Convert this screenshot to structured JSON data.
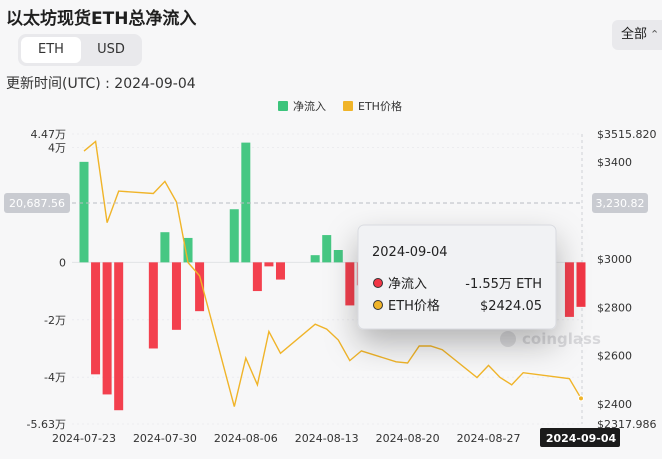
{
  "header": {
    "title": "以太坊现货ETH总净流入",
    "unit_toggle": [
      "ETH",
      "USD"
    ],
    "active_unit": "ETH",
    "update_time": "更新时间(UTC) : 2024-09-04",
    "range_label": "全部"
  },
  "watermark": "coinglass",
  "colors": {
    "inflow": "#3cc47c",
    "outflow": "#f23645",
    "price": "#f0b429"
  },
  "chart_data": {
    "type": "bar",
    "title": "以太坊现货ETH总净流入",
    "legend": [
      "净流入",
      "ETH价格"
    ],
    "legend_position": "top-center",
    "categories": [
      "2024-07-23",
      "2024-07-24",
      "2024-07-25",
      "2024-07-26",
      "2024-07-29",
      "2024-07-30",
      "2024-07-31",
      "2024-08-01",
      "2024-08-02",
      "2024-08-05",
      "2024-08-06",
      "2024-08-07",
      "2024-08-08",
      "2024-08-09",
      "2024-08-12",
      "2024-08-13",
      "2024-08-14",
      "2024-08-15",
      "2024-08-16",
      "2024-08-19",
      "2024-08-20",
      "2024-08-21",
      "2024-08-22",
      "2024-08-23",
      "2024-08-26",
      "2024-08-27",
      "2024-08-28",
      "2024-08-29",
      "2024-08-30",
      "2024-09-03",
      "2024-09-04"
    ],
    "series": [
      {
        "name": "净流入",
        "axis": "left",
        "values": [
          35000,
          -39000,
          -46000,
          -51500,
          -30000,
          10500,
          -23500,
          8500,
          -17000,
          18500,
          41700,
          -10000,
          -1400,
          -6000,
          2500,
          9500,
          4300,
          -15000,
          -8000,
          -6500,
          -10000,
          -18000,
          -3000,
          -5000,
          -9000,
          -14000,
          -4000,
          -10500,
          -7000,
          -19000,
          -15500
        ]
      },
      {
        "name": "ETH价格",
        "axis": "right",
        "values": [
          3445,
          3485,
          3150,
          3280,
          3270,
          3320,
          3235,
          2985,
          2930,
          2390,
          2590,
          2480,
          2700,
          2610,
          2730,
          2710,
          2665,
          2580,
          2620,
          2575,
          2570,
          2640,
          2640,
          2625,
          2510,
          2560,
          2510,
          2480,
          2530,
          2505,
          2424.05
        ]
      }
    ],
    "x_tick_labels": [
      "2024-07-23",
      "2024-07-30",
      "2024-08-06",
      "2024-08-13",
      "2024-08-20",
      "2024-08-27",
      "2024-09-04"
    ],
    "y_left": {
      "ticks": [
        "4.47万",
        "4万",
        "0",
        "-2万",
        "-4万",
        "-5.63万"
      ],
      "range": [
        -56300,
        44700
      ]
    },
    "y_right": {
      "ticks": [
        "$3515.820",
        "$3400",
        "$3000",
        "$2800",
        "$2600",
        "$2400",
        "$2317.986"
      ],
      "range": [
        2317.986,
        3515.82
      ]
    },
    "crosshair": {
      "left_value": "20,687.56",
      "right_value": "3,230.82"
    },
    "tooltip": {
      "date": "2024-09-04",
      "rows": [
        {
          "label": "净流入",
          "value": "-1.55万 ETH"
        },
        {
          "label": "ETH价格",
          "value": "$2424.05"
        }
      ]
    }
  }
}
